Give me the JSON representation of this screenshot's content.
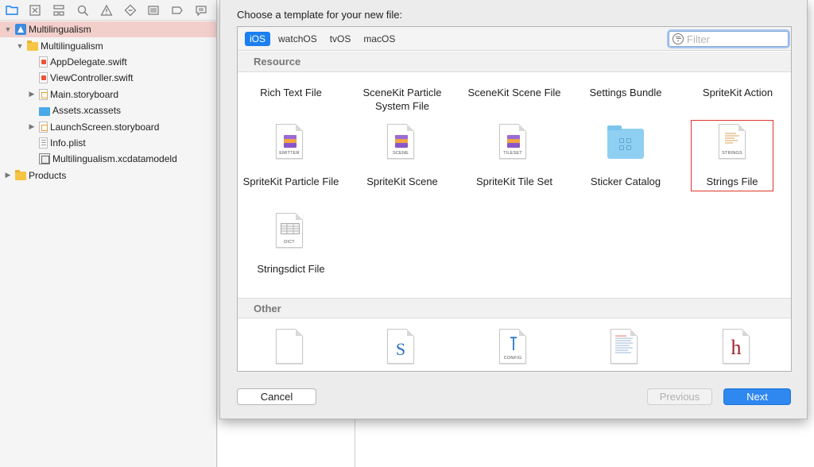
{
  "navigator": {
    "toolbar_icons": [
      "folder-icon",
      "source-control-icon",
      "hierarchy-icon",
      "search-icon",
      "warning-icon",
      "test-icon",
      "debug-icon",
      "breakpoint-icon",
      "report-icon"
    ],
    "tree": [
      {
        "label": "Multilingualism",
        "icon": "project-icon",
        "indent": 0,
        "disclosure": "open",
        "selected": true
      },
      {
        "label": "Multilingualism",
        "icon": "folder-icon",
        "indent": 1,
        "disclosure": "open"
      },
      {
        "label": "AppDelegate.swift",
        "icon": "swift-file-icon",
        "indent": 2,
        "disclosure": ""
      },
      {
        "label": "ViewController.swift",
        "icon": "swift-file-icon",
        "indent": 2,
        "disclosure": ""
      },
      {
        "label": "Main.storyboard",
        "icon": "storyboard-icon",
        "indent": 2,
        "disclosure": "closed"
      },
      {
        "label": "Assets.xcassets",
        "icon": "assets-icon",
        "indent": 2,
        "disclosure": ""
      },
      {
        "label": "LaunchScreen.storyboard",
        "icon": "storyboard-icon",
        "indent": 2,
        "disclosure": "closed"
      },
      {
        "label": "Info.plist",
        "icon": "plist-icon",
        "indent": 2,
        "disclosure": ""
      },
      {
        "label": "Multilingualism.xcdatamodeld",
        "icon": "datamodel-icon",
        "indent": 2,
        "disclosure": ""
      },
      {
        "label": "Products",
        "icon": "folder-icon",
        "indent": 0,
        "disclosure": "closed"
      }
    ]
  },
  "sheet": {
    "title": "Choose a template for your new file:",
    "tabs": [
      "iOS",
      "watchOS",
      "tvOS",
      "macOS"
    ],
    "active_tab": "iOS",
    "filter": {
      "placeholder": "Filter",
      "value": ""
    },
    "sections": {
      "resource": "Resource",
      "other": "Other"
    },
    "resource_row1": [
      "Rich Text File",
      "SceneKit Particle System File",
      "SceneKit Scene File",
      "Settings Bundle",
      "SpriteKit Action"
    ],
    "resource_row2": [
      {
        "label": "SpriteKit Particle File",
        "caption": "EMITTER"
      },
      {
        "label": "SpriteKit Scene",
        "caption": "SCENE"
      },
      {
        "label": "SpriteKit Tile Set",
        "caption": "TILESET"
      },
      {
        "label": "Sticker Catalog",
        "caption": ""
      },
      {
        "label": "Strings File",
        "caption": "STRINGS"
      }
    ],
    "resource_row3": [
      {
        "label": "Stringsdict File",
        "caption": "DICT"
      }
    ],
    "other_icons": [
      {
        "caption": "",
        "glyph": ""
      },
      {
        "caption": "",
        "glyph": "S"
      },
      {
        "caption": "CONFIG",
        "glyph": ""
      },
      {
        "caption": "",
        "glyph": ""
      },
      {
        "caption": "",
        "glyph": "h"
      }
    ],
    "selected_template": "Strings File",
    "buttons": {
      "cancel": "Cancel",
      "previous": "Previous",
      "next": "Next"
    }
  },
  "colors": {
    "accent": "#1b7ff0",
    "selection_row": "#f2cfcb",
    "selected_outline": "#e0332b"
  }
}
